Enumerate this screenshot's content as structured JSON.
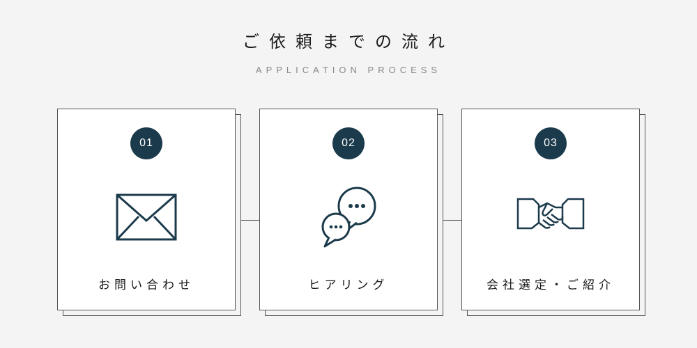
{
  "header": {
    "title": "ご依頼までの流れ",
    "subtitle": "APPLICATION PROCESS"
  },
  "steps": [
    {
      "number": "01",
      "title": "お問い合わせ",
      "icon": "envelope-icon"
    },
    {
      "number": "02",
      "title": "ヒアリング",
      "icon": "speech-bubbles-icon"
    },
    {
      "number": "03",
      "title": "会社選定・ご紹介",
      "icon": "handshake-icon"
    }
  ],
  "colors": {
    "badge_bg": "#1b3a4b",
    "page_bg": "#f4f4f4",
    "stroke": "#1b3a4b"
  }
}
